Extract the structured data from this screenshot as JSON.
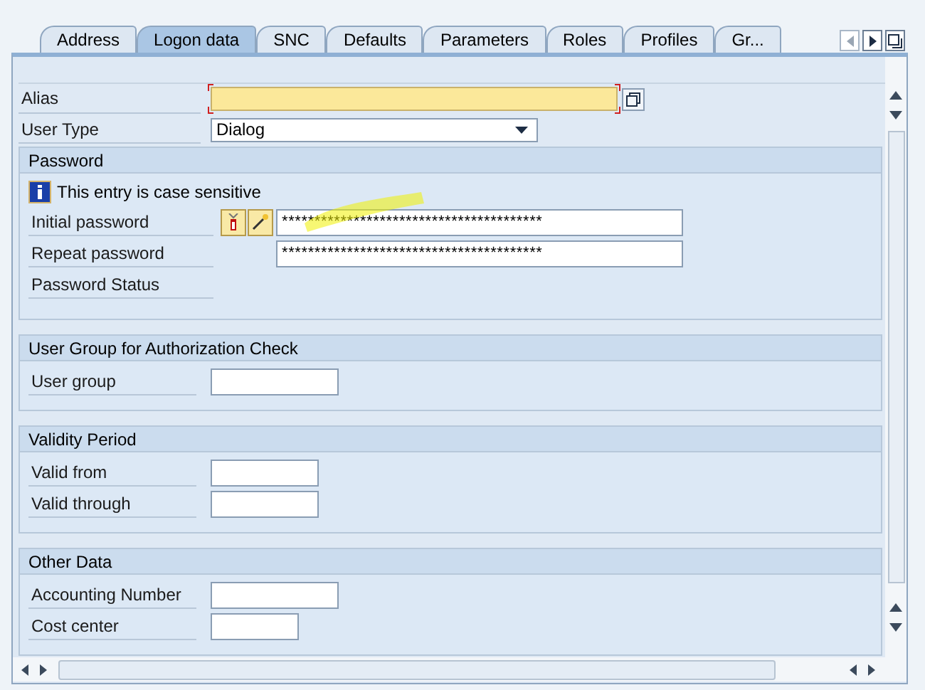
{
  "tabs": [
    {
      "label": "Address",
      "selected": false
    },
    {
      "label": "Logon data",
      "selected": true
    },
    {
      "label": "SNC",
      "selected": false
    },
    {
      "label": "Defaults",
      "selected": false
    },
    {
      "label": "Parameters",
      "selected": false
    },
    {
      "label": "Roles",
      "selected": false
    },
    {
      "label": "Profiles",
      "selected": false
    },
    {
      "label": "Gr...",
      "selected": false
    }
  ],
  "top_fields": [
    {
      "label": "Alias",
      "kind": "input",
      "required": true
    },
    {
      "label": "User Type",
      "kind": "dropdown",
      "value": "Dialog"
    }
  ],
  "sections": [
    {
      "title": "Password",
      "message": "This entry is case sensitive",
      "rows": [
        {
          "label": "Initial password",
          "kind": "password",
          "value": "****************************************",
          "tools": true
        },
        {
          "label": "Repeat password",
          "kind": "password",
          "value": "****************************************",
          "tools": false
        },
        {
          "label": "Password Status",
          "kind": "text",
          "tools": false
        }
      ]
    },
    {
      "title": "User Group for Authorization Check",
      "rows": [
        {
          "label": "User group",
          "kind": "input"
        }
      ]
    },
    {
      "title": "Validity Period",
      "rows": [
        {
          "label": "Valid from",
          "kind": "input"
        },
        {
          "label": "Valid through",
          "kind": "input"
        }
      ]
    },
    {
      "title": "Other Data",
      "rows": [
        {
          "label": "Accounting Number",
          "kind": "input"
        },
        {
          "label": "Cost center",
          "kind": "input"
        }
      ]
    }
  ]
}
